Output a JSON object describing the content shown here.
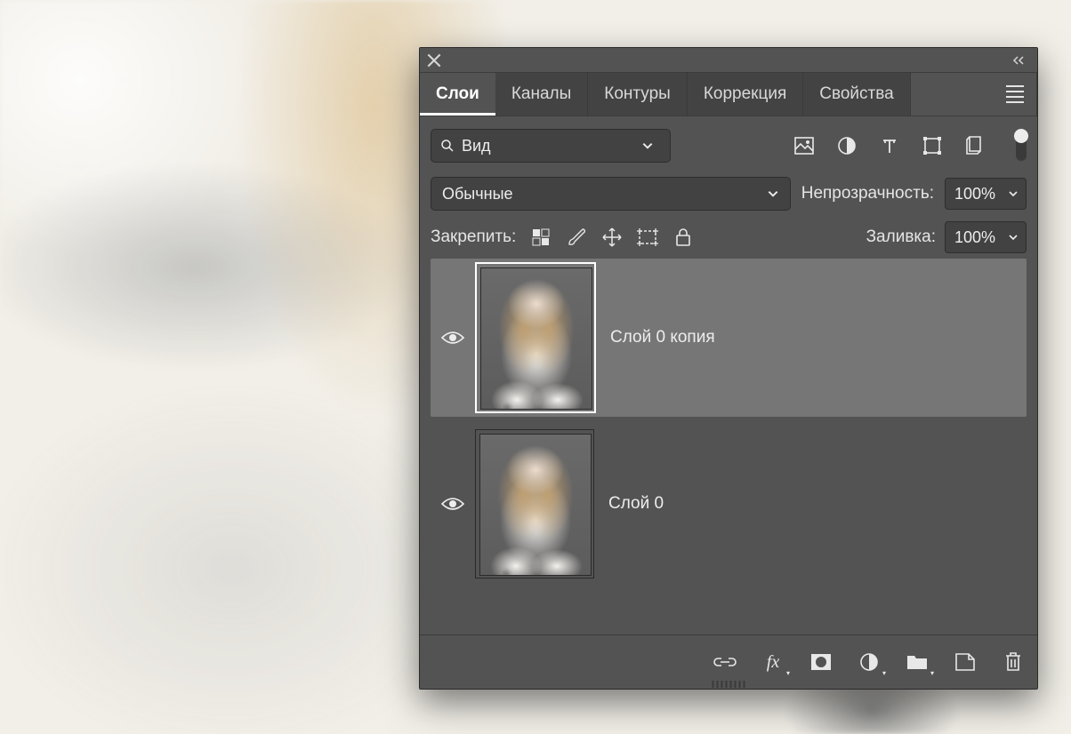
{
  "tabs": {
    "layers": "Слои",
    "channels": "Каналы",
    "paths": "Контуры",
    "adjust": "Коррекция",
    "props": "Свойства"
  },
  "search": {
    "label": "Вид"
  },
  "blend": {
    "mode": "Обычные"
  },
  "opacity": {
    "label": "Непрозрачность:",
    "value": "100%"
  },
  "lock": {
    "label": "Закрепить:"
  },
  "fill": {
    "label": "Заливка:",
    "value": "100%"
  },
  "layers": [
    {
      "name": "Слой 0 копия",
      "selected": true,
      "visible": true
    },
    {
      "name": "Слой 0",
      "selected": false,
      "visible": true
    }
  ],
  "icons": {
    "filter_image": "image-icon",
    "filter_adjust": "adjust-icon",
    "filter_type": "type-icon",
    "filter_shape": "shape-icon",
    "filter_smart": "smartobj-icon",
    "lock_pixels": "lock-pixels-icon",
    "lock_brush": "lock-brush-icon",
    "lock_move": "lock-move-icon",
    "lock_artboard": "lock-artboard-icon",
    "lock_all": "lock-all-icon",
    "bottom_link": "link-icon",
    "bottom_fx": "fx-icon",
    "bottom_mask": "mask-icon",
    "bottom_adjust": "adjustment-icon",
    "bottom_group": "group-icon",
    "bottom_new": "new-layer-icon",
    "bottom_trash": "trash-icon"
  }
}
